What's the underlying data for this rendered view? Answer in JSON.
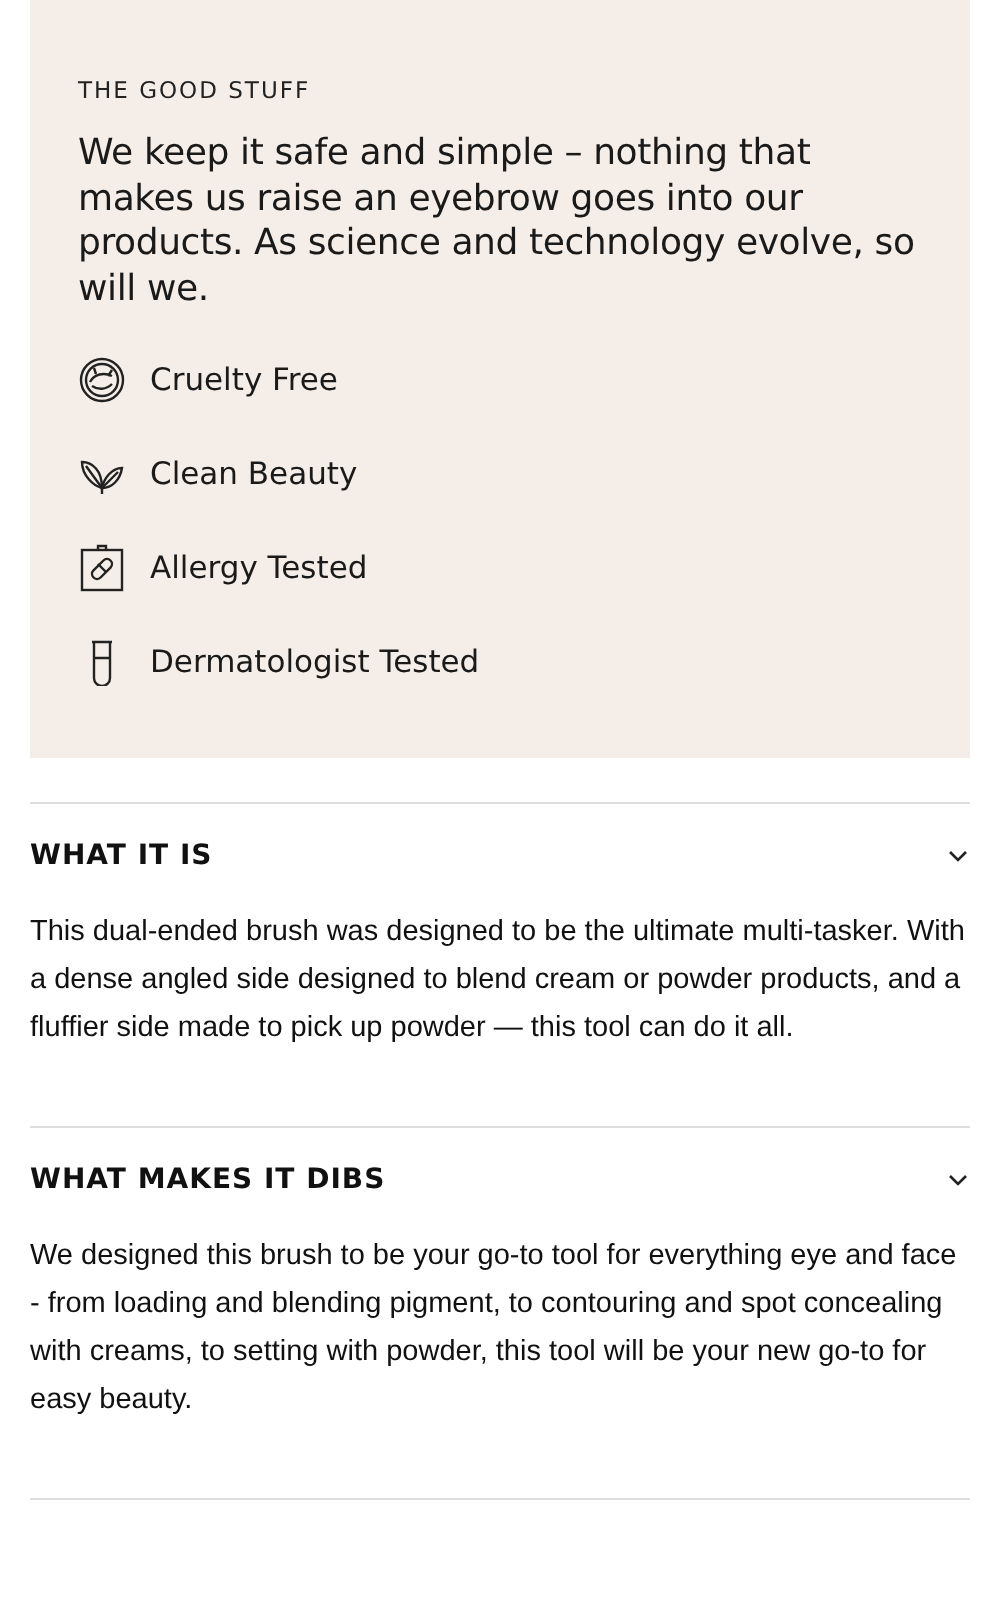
{
  "good_stuff": {
    "eyebrow": "THE GOOD STUFF",
    "heading": "We keep it safe and simple – nothing that makes us raise an eyebrow goes into our products. As science and technology evolve, so will we.",
    "features": [
      {
        "kind": "cruelty",
        "label": "Cruelty Free"
      },
      {
        "kind": "leaf",
        "label": "Clean Beauty"
      },
      {
        "kind": "allergy",
        "label": "Allergy Tested"
      },
      {
        "kind": "tube",
        "label": "Dermatologist Tested"
      }
    ]
  },
  "sections": [
    {
      "title": "WHAT IT IS",
      "expanded": true,
      "body": "This dual-ended brush was designed to be the ultimate multi-tasker. With a dense angled side designed to blend cream or powder products, and a fluffier side made to pick up powder — this tool can do it all."
    },
    {
      "title": "WHAT MAKES IT DIBS",
      "expanded": true,
      "body": "We designed this brush to be your go-to tool for everything eye and face - from loading and blending pigment, to contouring and spot concealing with creams, to setting with powder, this tool will be your new go-to for easy beauty."
    }
  ]
}
